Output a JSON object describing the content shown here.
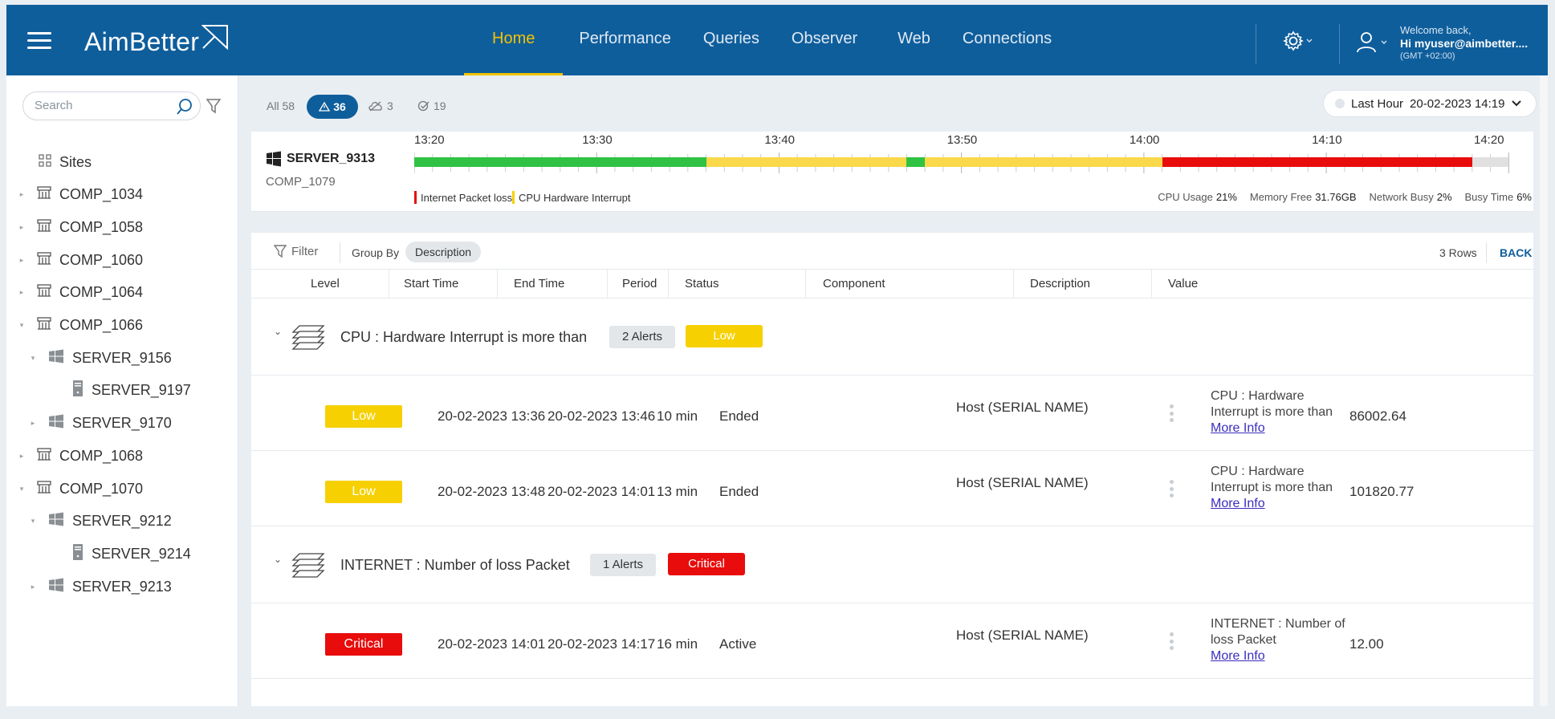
{
  "header": {
    "brand": "AimBetter",
    "nav": [
      "Home",
      "Performance",
      "Queries",
      "Observer",
      "Web",
      "Connections"
    ],
    "active_nav": "Home",
    "welcome_line1": "Welcome back,",
    "welcome_line2": "Hi myuser@aimbetter....",
    "timezone": "(GMT +02:00)"
  },
  "sidebar": {
    "search_placeholder": "Search",
    "items": [
      {
        "label": "Sites",
        "level": 0,
        "icon": "sites-grid-icon",
        "caret": ""
      },
      {
        "label": "COMP_1034",
        "level": 0,
        "icon": "computer-icon",
        "caret": "collapsed"
      },
      {
        "label": "COMP_1058",
        "level": 0,
        "icon": "computer-icon",
        "caret": "collapsed"
      },
      {
        "label": "COMP_1060",
        "level": 0,
        "icon": "computer-icon",
        "caret": "collapsed"
      },
      {
        "label": "COMP_1064",
        "level": 0,
        "icon": "computer-icon",
        "caret": "collapsed"
      },
      {
        "label": "COMP_1066",
        "level": 0,
        "icon": "computer-icon",
        "caret": "expanded"
      },
      {
        "label": "SERVER_9156",
        "level": 1,
        "icon": "windows-icon",
        "caret": "expanded"
      },
      {
        "label": "SERVER_9197",
        "level": 2,
        "icon": "server-icon",
        "caret": ""
      },
      {
        "label": "SERVER_9170",
        "level": 1,
        "icon": "windows-icon",
        "caret": "collapsed"
      },
      {
        "label": "COMP_1068",
        "level": 0,
        "icon": "computer-icon",
        "caret": "collapsed"
      },
      {
        "label": "COMP_1070",
        "level": 0,
        "icon": "computer-icon",
        "caret": "expanded"
      },
      {
        "label": "SERVER_9212",
        "level": 1,
        "icon": "windows-icon",
        "caret": "expanded"
      },
      {
        "label": "SERVER_9214",
        "level": 2,
        "icon": "server-icon",
        "caret": ""
      },
      {
        "label": "SERVER_9213",
        "level": 1,
        "icon": "windows-icon",
        "caret": "collapsed"
      }
    ]
  },
  "filters": {
    "all_label": "All 58",
    "alerts_count": "36",
    "cloud_count": "3",
    "resolved_count": "19"
  },
  "timepicker": {
    "range": "Last Hour",
    "datetime": "20-02-2023 14:19"
  },
  "server": {
    "name": "SERVER_9313",
    "comp": "COMP_1079",
    "time_labels": [
      "13:20",
      "13:30",
      "13:40",
      "13:50",
      "14:00",
      "14:10",
      "14:20"
    ],
    "timeline_segments": [
      {
        "start_min": 0,
        "end_min": 16,
        "status": "ok"
      },
      {
        "start_min": 16,
        "end_min": 27,
        "status": "warning"
      },
      {
        "start_min": 27,
        "end_min": 28,
        "status": "ok"
      },
      {
        "start_min": 28,
        "end_min": 41,
        "status": "warning"
      },
      {
        "start_min": 41,
        "end_min": 58,
        "status": "critical"
      },
      {
        "start_min": 58,
        "end_min": 60,
        "status": "none"
      }
    ],
    "legend": [
      {
        "label": "Internet Packet loss",
        "color": "#e80c0c"
      },
      {
        "label": "CPU Hardware Interrupt",
        "color": "#f6d000"
      }
    ],
    "stats": [
      {
        "label": "CPU Usage",
        "value": "21%"
      },
      {
        "label": "Memory Free",
        "value": "31.76GB"
      },
      {
        "label": "Network Busy",
        "value": "2%"
      },
      {
        "label": "Busy Time",
        "value": "6%"
      }
    ]
  },
  "colors": {
    "ok": "#2fc243",
    "warning": "#f9d94a",
    "critical": "#e80c0c",
    "none": "#e0e0e0",
    "brand": "#0f5e9c"
  },
  "table": {
    "filter_label": "Filter",
    "group_by_label": "Group By",
    "group_by_value": "Description",
    "rows_count": "3 Rows",
    "back_label": "BACK",
    "columns": [
      "Level",
      "Start Time",
      "End Time",
      "Period",
      "Status",
      "Component",
      "Description",
      "Value"
    ],
    "groups": [
      {
        "title": "CPU : Hardware Interrupt is more than",
        "alerts": "2 Alerts",
        "level": "Low",
        "rows": [
          {
            "level": "Low",
            "start": "20-02-2023 13:36",
            "end": "20-02-2023 13:46",
            "period": "10 min",
            "status": "Ended",
            "component": "Host (SERIAL NAME)",
            "desc": "CPU : Hardware Interrupt is more than",
            "more": "More Info",
            "value": "86002.64"
          },
          {
            "level": "Low",
            "start": "20-02-2023 13:48",
            "end": "20-02-2023 14:01",
            "period": "13 min",
            "status": "Ended",
            "component": "Host (SERIAL NAME)",
            "desc": "CPU : Hardware Interrupt is more than",
            "more": "More Info",
            "value": "101820.77"
          }
        ]
      },
      {
        "title": "INTERNET : Number of loss Packet",
        "alerts": "1 Alerts",
        "level": "Critical",
        "rows": [
          {
            "level": "Critical",
            "start": "20-02-2023 14:01",
            "end": "20-02-2023 14:17",
            "period": "16 min",
            "status": "Active",
            "component": "Host (SERIAL NAME)",
            "desc": "INTERNET : Number of loss Packet",
            "more": "More Info",
            "value": "12.00"
          }
        ]
      }
    ]
  }
}
